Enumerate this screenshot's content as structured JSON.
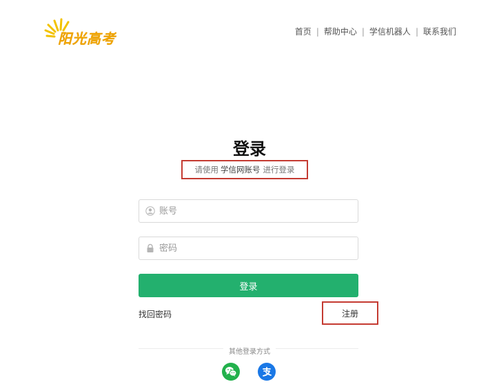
{
  "brand": {
    "logo_text": "阳光高考",
    "logo_color": "#f0a400"
  },
  "nav": {
    "items": [
      {
        "label": "首页"
      },
      {
        "label": "帮助中心"
      },
      {
        "label": "学信机器人"
      },
      {
        "label": "联系我们"
      }
    ],
    "separator": "|"
  },
  "login": {
    "title": "登录",
    "hint_prefix": "请使用",
    "hint_account": "学信网账号",
    "hint_suffix": "进行登录",
    "account_placeholder": "账号",
    "password_placeholder": "密码",
    "submit_label": "登录",
    "forgot_label": "找回密码",
    "register_label": "注册",
    "other_methods_label": "其他登录方式"
  },
  "social": [
    {
      "name": "wechat",
      "icon": "wechat-icon",
      "color": "#22b14c"
    },
    {
      "name": "alipay",
      "icon": "alipay-icon",
      "color": "#1a78e6"
    }
  ],
  "colors": {
    "primary": "#23b06e",
    "highlight_border": "#c43a31"
  }
}
